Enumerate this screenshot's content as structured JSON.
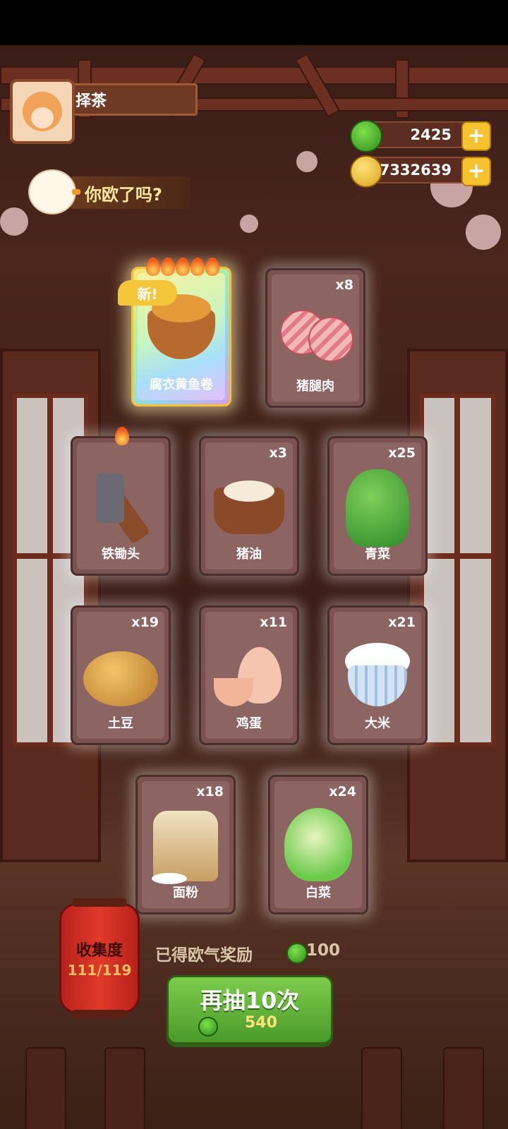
{
  "player": {
    "name": "择茶"
  },
  "currency": {
    "gems": "2425",
    "coins": "7332639",
    "gem_color": "#4caf2a",
    "coin_color": "#f2c230"
  },
  "banner": {
    "text": "你欧了吗?"
  },
  "cards": [
    {
      "name": "腐衣黄鱼卷",
      "count": "",
      "new": "新!",
      "flames": 5,
      "featured": true,
      "icon": "fish-roll-dish-icon"
    },
    {
      "name": "猪腿肉",
      "count": "x8",
      "icon": "pork-leg-icon"
    },
    {
      "name": "铁锄头",
      "count": "",
      "flames": 1,
      "icon": "iron-hoe-icon"
    },
    {
      "name": "猪油",
      "count": "x3",
      "icon": "lard-icon"
    },
    {
      "name": "青菜",
      "count": "x25",
      "icon": "greens-icon"
    },
    {
      "name": "土豆",
      "count": "x19",
      "icon": "potato-icon"
    },
    {
      "name": "鸡蛋",
      "count": "x11",
      "icon": "egg-icon"
    },
    {
      "name": "大米",
      "count": "x21",
      "icon": "rice-bowl-icon"
    },
    {
      "name": "面粉",
      "count": "x18",
      "icon": "flour-sack-icon"
    },
    {
      "name": "白菜",
      "count": "x24",
      "icon": "napa-cabbage-icon"
    }
  ],
  "collection": {
    "label": "收集度",
    "value": "111/119"
  },
  "reward": {
    "label": "已得欧气奖励",
    "amount": "100"
  },
  "draw_button": {
    "label": "再抽10次",
    "cost": "540"
  }
}
